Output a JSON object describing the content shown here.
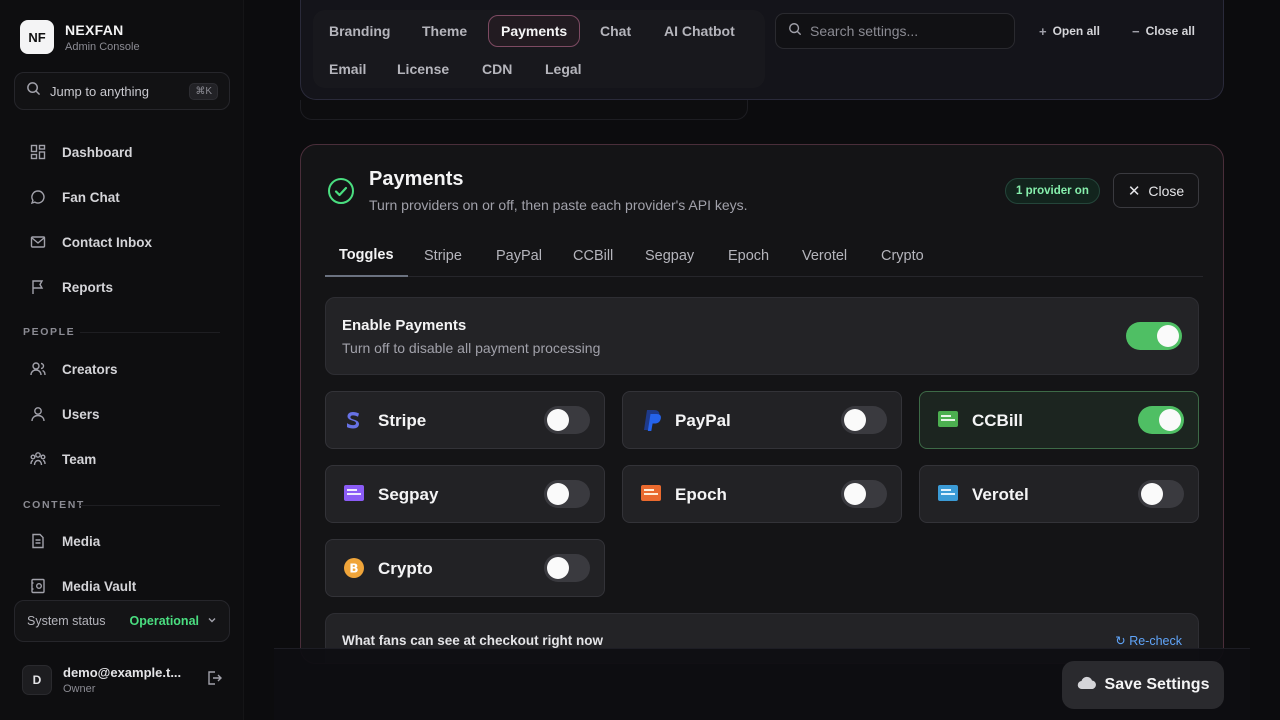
{
  "brand": {
    "logo": "NF",
    "name": "NEXFAN",
    "subtitle": "Admin Console"
  },
  "jump": {
    "label": "Jump to anything",
    "shortcut": "⌘K"
  },
  "nav": {
    "main": [
      {
        "label": "Dashboard",
        "icon": "dashboard-icon"
      },
      {
        "label": "Fan Chat",
        "icon": "chat-bubble-icon"
      },
      {
        "label": "Contact Inbox",
        "icon": "mail-icon"
      },
      {
        "label": "Reports",
        "icon": "flag-icon"
      }
    ],
    "people_label": "PEOPLE",
    "people": [
      {
        "label": "Creators",
        "icon": "creators-icon"
      },
      {
        "label": "Users",
        "icon": "user-icon"
      },
      {
        "label": "Team",
        "icon": "team-icon"
      }
    ],
    "content_label": "CONTENT",
    "content": [
      {
        "label": "Media",
        "icon": "media-icon"
      },
      {
        "label": "Media Vault",
        "icon": "vault-icon"
      }
    ]
  },
  "system_status": {
    "label": "System status",
    "value": "Operational"
  },
  "user": {
    "initial": "D",
    "email": "demo@example.t...",
    "role": "Owner"
  },
  "settings_tabs": [
    "Branding",
    "Theme",
    "Payments",
    "Chat",
    "AI Chatbot",
    "Email",
    "License",
    "CDN",
    "Legal"
  ],
  "search": {
    "placeholder": "Search settings..."
  },
  "actions": {
    "open_all": "Open all",
    "close_all": "Close all"
  },
  "payments": {
    "title": "Payments",
    "subtitle": "Turn providers on or off, then paste each provider's API keys.",
    "badge": "1 provider on",
    "close_label": "Close",
    "subtabs": [
      "Toggles",
      "Stripe",
      "PayPal",
      "CCBill",
      "Segpay",
      "Epoch",
      "Verotel",
      "Crypto"
    ],
    "enable": {
      "title": "Enable Payments",
      "subtitle": "Turn off to disable all payment processing",
      "on": true
    },
    "providers": [
      {
        "name": "Stripe",
        "on": false,
        "color": "#6772e5"
      },
      {
        "name": "PayPal",
        "on": false,
        "color": "#1d4ed8"
      },
      {
        "name": "CCBill",
        "on": true,
        "color": "#4caf50"
      },
      {
        "name": "Segpay",
        "on": false,
        "color": "#8b5cf6"
      },
      {
        "name": "Epoch",
        "on": false,
        "color": "#ea6a2e"
      },
      {
        "name": "Verotel",
        "on": false,
        "color": "#3b9bd6"
      },
      {
        "name": "Crypto",
        "on": false,
        "color": "#f0a53a"
      }
    ],
    "checkout": {
      "title": "What fans can see at checkout right now",
      "recheck": "Re-check"
    }
  },
  "save_label": "Save Settings"
}
